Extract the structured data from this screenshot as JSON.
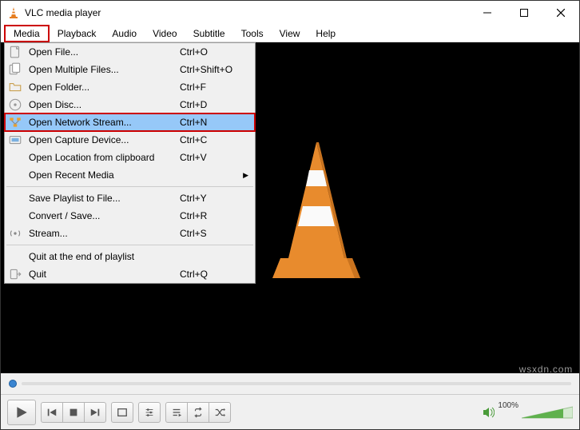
{
  "window": {
    "title": "VLC media player"
  },
  "menubar": {
    "items": [
      "Media",
      "Playback",
      "Audio",
      "Video",
      "Subtitle",
      "Tools",
      "View",
      "Help"
    ],
    "active_index": 0
  },
  "dropdown": {
    "open_file": {
      "label": "Open File...",
      "shortcut": "Ctrl+O"
    },
    "open_multiple": {
      "label": "Open Multiple Files...",
      "shortcut": "Ctrl+Shift+O"
    },
    "open_folder": {
      "label": "Open Folder...",
      "shortcut": "Ctrl+F"
    },
    "open_disc": {
      "label": "Open Disc...",
      "shortcut": "Ctrl+D"
    },
    "open_network": {
      "label": "Open Network Stream...",
      "shortcut": "Ctrl+N"
    },
    "open_capture": {
      "label": "Open Capture Device...",
      "shortcut": "Ctrl+C"
    },
    "open_clipboard": {
      "label": "Open Location from clipboard",
      "shortcut": "Ctrl+V"
    },
    "open_recent": {
      "label": "Open Recent Media",
      "shortcut": ""
    },
    "save_playlist": {
      "label": "Save Playlist to File...",
      "shortcut": "Ctrl+Y"
    },
    "convert": {
      "label": "Convert / Save...",
      "shortcut": "Ctrl+R"
    },
    "stream": {
      "label": "Stream...",
      "shortcut": "Ctrl+S"
    },
    "quit_end": {
      "label": "Quit at the end of playlist",
      "shortcut": ""
    },
    "quit": {
      "label": "Quit",
      "shortcut": "Ctrl+Q"
    }
  },
  "controls": {
    "volume_percent": "100%"
  },
  "watermark": "wsxdn.com",
  "colors": {
    "highlight": "#c00",
    "selection": "#96c8f8",
    "cone_orange": "#e67e22"
  }
}
